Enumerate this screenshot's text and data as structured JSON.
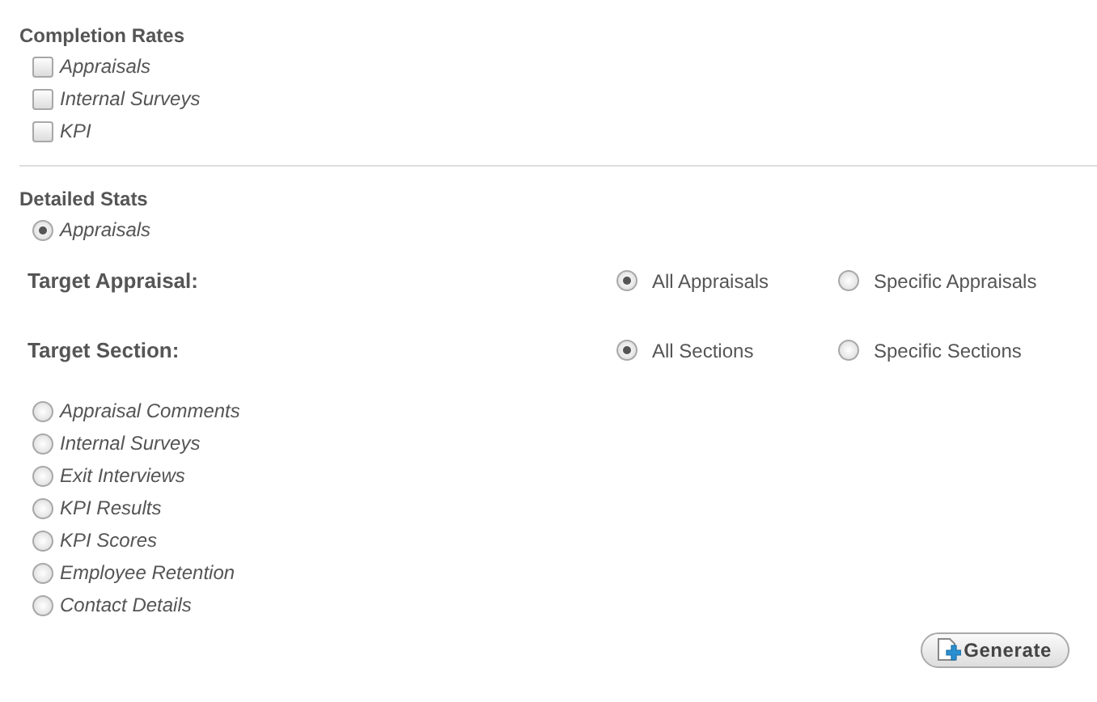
{
  "completion_rates": {
    "title": "Completion Rates",
    "options": [
      {
        "label": "Appraisals",
        "checked": false
      },
      {
        "label": "Internal Surveys",
        "checked": false
      },
      {
        "label": "KPI",
        "checked": false
      }
    ]
  },
  "detailed_stats": {
    "title": "Detailed Stats",
    "first_option": {
      "label": "Appraisals",
      "selected": true
    },
    "targets": [
      {
        "label": "Target Appraisal:",
        "options": [
          {
            "label": "All Appraisals",
            "selected": true
          },
          {
            "label": "Specific Appraisals",
            "selected": false
          }
        ]
      },
      {
        "label": "Target Section:",
        "options": [
          {
            "label": "All Sections",
            "selected": true
          },
          {
            "label": "Specific Sections",
            "selected": false
          }
        ]
      }
    ],
    "options": [
      {
        "label": "Appraisal Comments",
        "selected": false
      },
      {
        "label": "Internal Surveys",
        "selected": false
      },
      {
        "label": "Exit Interviews",
        "selected": false
      },
      {
        "label": "KPI Results",
        "selected": false
      },
      {
        "label": "KPI Scores",
        "selected": false
      },
      {
        "label": "Employee Retention",
        "selected": false
      },
      {
        "label": "Contact Details",
        "selected": false
      }
    ]
  },
  "generate_button": {
    "label": "Generate"
  }
}
